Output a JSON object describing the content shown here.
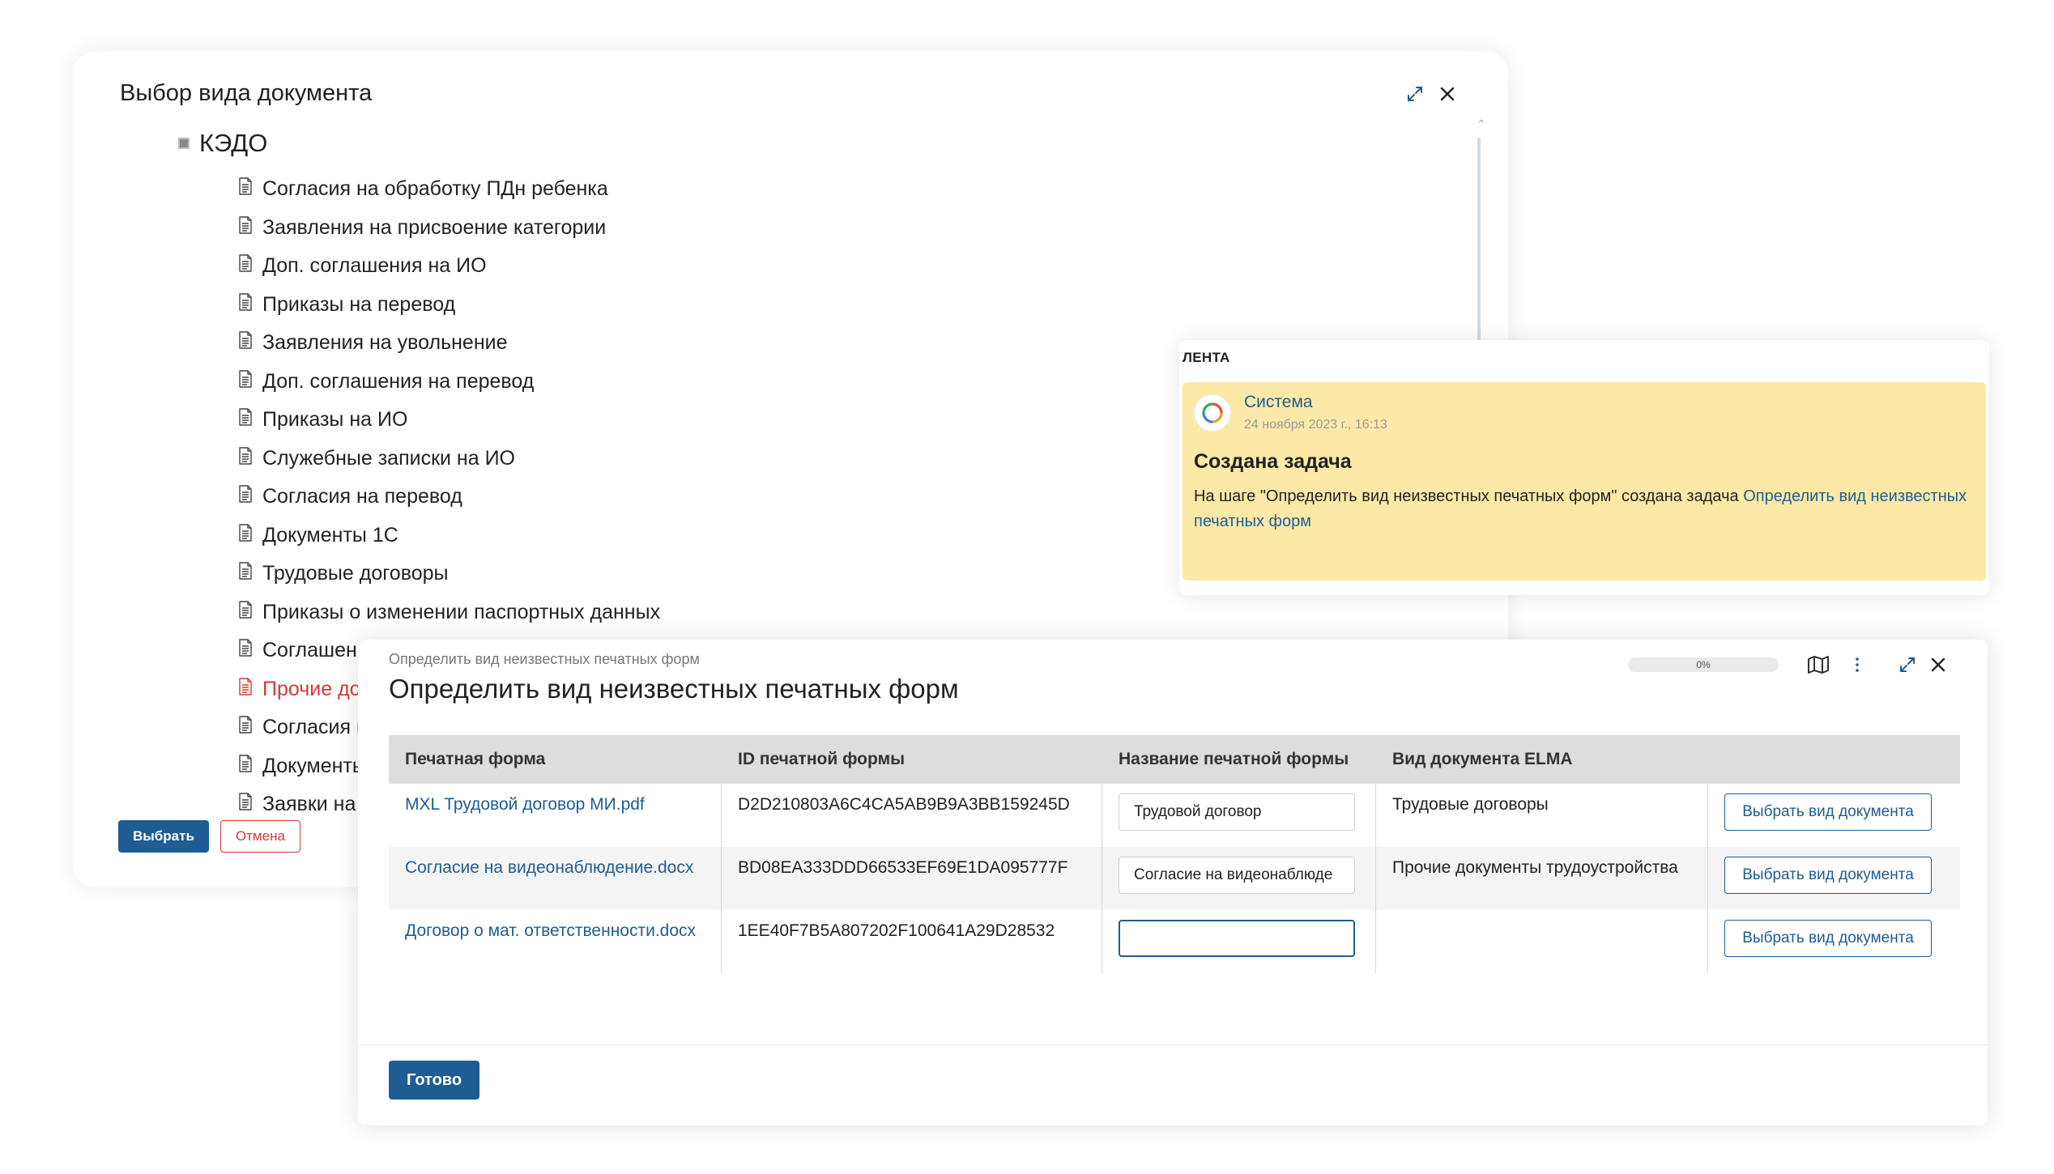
{
  "picker": {
    "title": "Выбор вида документа",
    "root": "КЭДО",
    "items": [
      {
        "label": "Согласия на обработку ПДн ребенка",
        "highlight": false
      },
      {
        "label": "Заявления на присвоение категории",
        "highlight": false
      },
      {
        "label": "Доп. соглашения на ИО",
        "highlight": false
      },
      {
        "label": "Приказы на перевод",
        "highlight": false
      },
      {
        "label": "Заявления на увольнение",
        "highlight": false
      },
      {
        "label": "Доп. соглашения на перевод",
        "highlight": false
      },
      {
        "label": "Приказы на ИО",
        "highlight": false
      },
      {
        "label": "Служебные записки на ИО",
        "highlight": false
      },
      {
        "label": "Согласия на перевод",
        "highlight": false
      },
      {
        "label": "Документы 1С",
        "highlight": false
      },
      {
        "label": "Трудовые договоры",
        "highlight": false
      },
      {
        "label": "Приказы о изменении паспортных данных",
        "highlight": false
      },
      {
        "label": "Соглашени",
        "highlight": false
      },
      {
        "label": "Прочие до",
        "highlight": true
      },
      {
        "label": "Согласия н",
        "highlight": false
      },
      {
        "label": "Документы",
        "highlight": false
      },
      {
        "label": "Заявки на",
        "highlight": false
      }
    ],
    "select_label": "Выбрать",
    "cancel_label": "Отмена"
  },
  "feed": {
    "title": "ЛЕНТА",
    "author": "Система",
    "date": "24 ноября 2023 г., 16:13",
    "heading": "Создана задача",
    "text_prefix": "На шаге \"Определить вид неизвестных печатных форм\" создана задача ",
    "text_link": "Определить вид неизвестных печатных форм",
    "card_color": "#fde9a7"
  },
  "task": {
    "breadcrumb": "Определить вид неизвестных печатных форм",
    "title": "Определить вид неизвестных печатных форм",
    "progress_percent": 0,
    "progress_label": "0%",
    "columns": [
      "Печатная форма",
      "ID печатной формы",
      "Название печатной формы",
      "Вид документа ELMA",
      ""
    ],
    "rows": [
      {
        "file": "MXL Трудовой договор МИ.pdf",
        "id": "D2D210803A6C4CA5AB9B9A3BB159245D",
        "name": "Трудовой договор",
        "doc_type": "Трудовые договоры",
        "action": "Выбрать вид документа"
      },
      {
        "file": "Согласие на видеонаблюдение.docx",
        "id": "BD08EA333DDD66533EF69E1DA095777F",
        "name": "Согласие на видеонаблюде",
        "doc_type": "Прочие документы трудоустройства",
        "action": "Выбрать вид документа"
      },
      {
        "file": "Договор о мат. ответственности.docx",
        "id": "1EE40F7B5A807202F100641A29D28532",
        "name": "",
        "doc_type": "",
        "action": "Выбрать вид документа"
      }
    ],
    "done_label": "Готово"
  },
  "colors": {
    "accent": "#1e5d94",
    "danger": "#d43a3a"
  }
}
